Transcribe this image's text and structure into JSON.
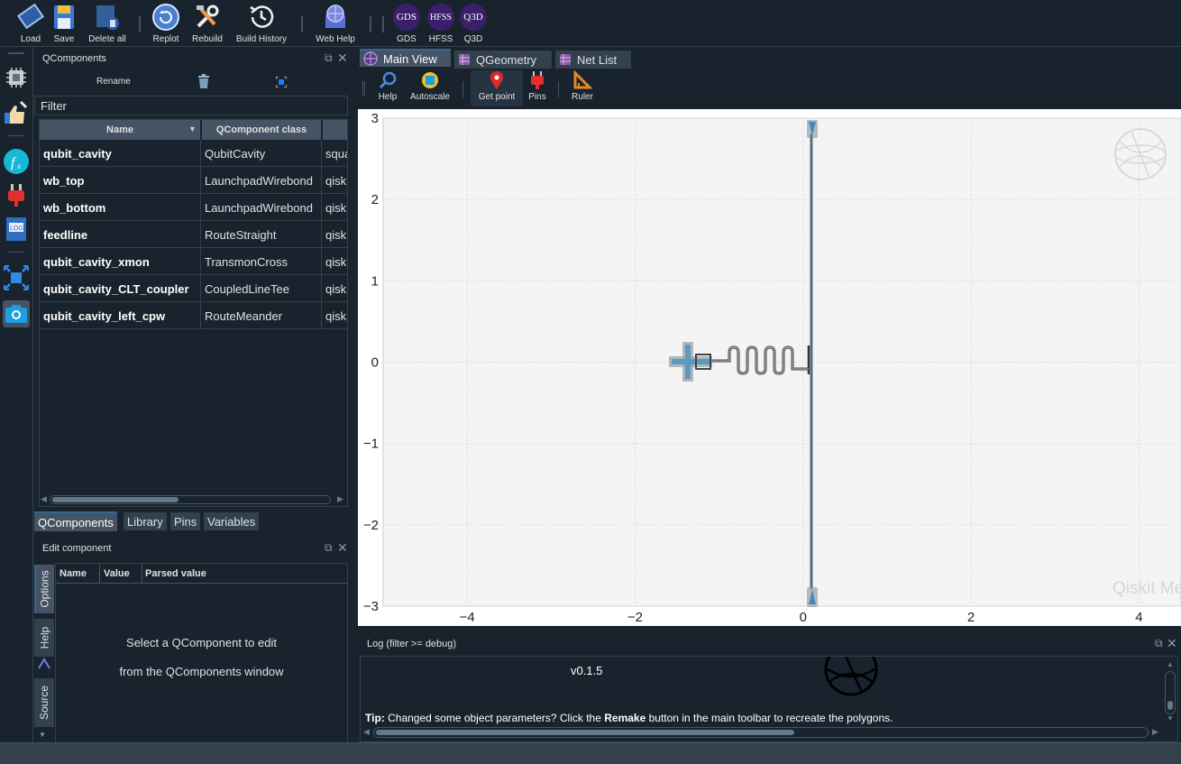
{
  "toolbar": {
    "load": "Load",
    "save": "Save",
    "delete_all": "Delete all",
    "replot": "Replot",
    "rebuild": "Rebuild",
    "build_history": "Build History",
    "web_help": "Web Help",
    "gds_icon_text": "GDS",
    "gds": "GDS",
    "hfss_icon_text": "HFSS",
    "hfss": "HFSS",
    "q3d_icon_text": "Q3D",
    "q3d": "Q3D"
  },
  "qcomponents": {
    "title": "QComponents",
    "rename": "Rename",
    "filter_placeholder": "Filter",
    "columns": [
      "Name",
      "QComponent class"
    ],
    "rows": [
      {
        "name": "qubit_cavity",
        "cls": "QubitCavity",
        "opt": "squa"
      },
      {
        "name": "wb_top",
        "cls": "LaunchpadWirebond",
        "opt": "qisk"
      },
      {
        "name": "wb_bottom",
        "cls": "LaunchpadWirebond",
        "opt": "qisk"
      },
      {
        "name": "feedline",
        "cls": "RouteStraight",
        "opt": "qisk"
      },
      {
        "name": "qubit_cavity_xmon",
        "cls": "TransmonCross",
        "opt": "qisk"
      },
      {
        "name": "qubit_cavity_CLT_coupler",
        "cls": "CoupledLineTee",
        "opt": "qisk"
      },
      {
        "name": "qubit_cavity_left_cpw",
        "cls": "RouteMeander",
        "opt": "qisk"
      }
    ],
    "tabs": [
      "QComponents",
      "Library",
      "Pins",
      "Variables"
    ]
  },
  "edit": {
    "title": "Edit component",
    "columns": [
      "Name",
      "Value",
      "Parsed value"
    ],
    "message_line1": "Select a QComponent to edit",
    "message_line2": "from the QComponents window",
    "vtabs": [
      "Options",
      "Help",
      "Source"
    ]
  },
  "main": {
    "tabs": [
      "Main View",
      "QGeometry",
      "Net List"
    ],
    "plot_tools": [
      "Help",
      "Autoscale",
      "Get point",
      "Pins",
      "Ruler"
    ],
    "watermark": "Qiskit Metal"
  },
  "chart_data": {
    "type": "scatter",
    "xlim": [
      -5.0,
      4.5
    ],
    "ylim": [
      -3.0,
      3.0
    ],
    "x_ticks": [
      "−4",
      "−2",
      "0",
      "2",
      "4"
    ],
    "y_ticks": [
      "3",
      "2",
      "1",
      "0",
      "−1",
      "−2",
      "−3"
    ],
    "x_tick_values": [
      -4,
      -2,
      0,
      2,
      4
    ],
    "y_tick_values": [
      3,
      2,
      1,
      0,
      -1,
      -2,
      -3
    ],
    "grid": true
  },
  "log": {
    "title": "Log  (filter >= debug)",
    "version": "v0.1.5",
    "tip_label": "Tip:",
    "tip_text1": " Changed some object parameters? Click the ",
    "tip_bold": "Remake",
    "tip_text2": " button in the main toolbar to recreate the polygons."
  }
}
